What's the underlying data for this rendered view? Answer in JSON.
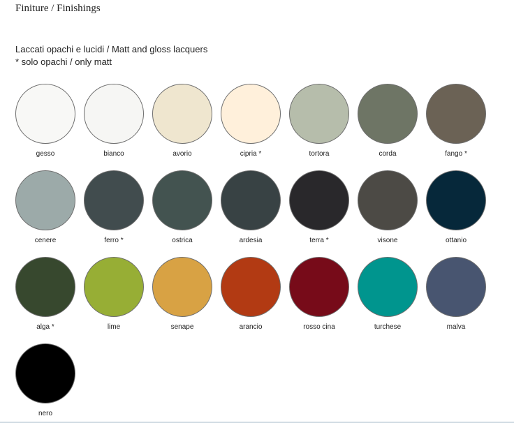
{
  "page": {
    "title": "Finiture / Finishings"
  },
  "section": {
    "heading": "Laccati opachi e lucidi / Matt and gloss lacquers",
    "note": "*  solo opachi / only matt"
  },
  "swatches": [
    {
      "label": "gesso",
      "color": "#f8f8f6"
    },
    {
      "label": "bianco",
      "color": "#f6f6f4"
    },
    {
      "label": "avorio",
      "color": "#efe6cf"
    },
    {
      "label": "cipria *",
      "color": "#fff0db"
    },
    {
      "label": "tortora",
      "color": "#b6bdab"
    },
    {
      "label": "corda",
      "color": "#6e7565"
    },
    {
      "label": "fango *",
      "color": "#6b6255"
    },
    {
      "label": "cenere",
      "color": "#9caaa9"
    },
    {
      "label": "ferro *",
      "color": "#414c4e"
    },
    {
      "label": "ostrica",
      "color": "#435350"
    },
    {
      "label": "ardesia",
      "color": "#384244"
    },
    {
      "label": "terra *",
      "color": "#29282b"
    },
    {
      "label": "visone",
      "color": "#4c4a45"
    },
    {
      "label": "ottanio",
      "color": "#06283a"
    },
    {
      "label": "alga *",
      "color": "#37482e"
    },
    {
      "label": "lime",
      "color": "#97ae35"
    },
    {
      "label": "senape",
      "color": "#d8a244"
    },
    {
      "label": "arancio",
      "color": "#b23a13"
    },
    {
      "label": "rosso cina",
      "color": "#770b19"
    },
    {
      "label": "turchese",
      "color": "#00958e"
    },
    {
      "label": "malva",
      "color": "#485570"
    },
    {
      "label": "nero",
      "color": "#000000"
    }
  ]
}
